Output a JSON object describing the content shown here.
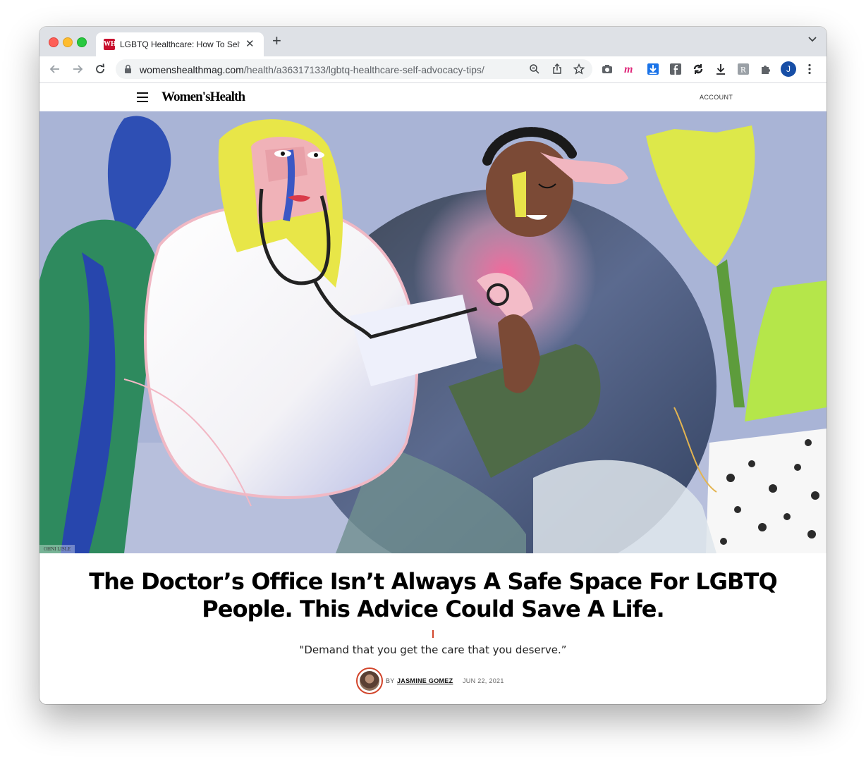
{
  "browser": {
    "tab": {
      "favicon": "WH",
      "title": "LGBTQ Healthcare: How To Self-Advocate",
      "close_icon": "close-icon"
    },
    "new_tab_label": "+",
    "url": {
      "host": "womenshealthmag.com",
      "path": "/health/a36317133/lgbtq-healthcare-self-advocacy-tips/"
    },
    "profile_initial": "J",
    "extensions": [
      "camera-icon",
      "m-extension-icon",
      "download-arrow-icon",
      "facebook-icon",
      "sync-icon",
      "download-icon",
      "r-extension-icon",
      "puzzle-icon"
    ]
  },
  "site": {
    "brand": "Women'sHealth",
    "account_label": "ACCOUNT"
  },
  "article": {
    "image_credit": "OHNI LISLE",
    "headline": "The Doctor’s Office Isn’t Always A Safe Space For LGBTQ People. This Advice Could Save A Life.",
    "dek": "\"Demand that you get the care that you deserve.”",
    "byline_prefix": "BY",
    "author": "JASMINE GOMEZ",
    "date": "JUN 22, 2021"
  },
  "colors": {
    "accent": "#d2452b",
    "tabbar": "#dee1e6",
    "brand_red": "#c8102e"
  }
}
